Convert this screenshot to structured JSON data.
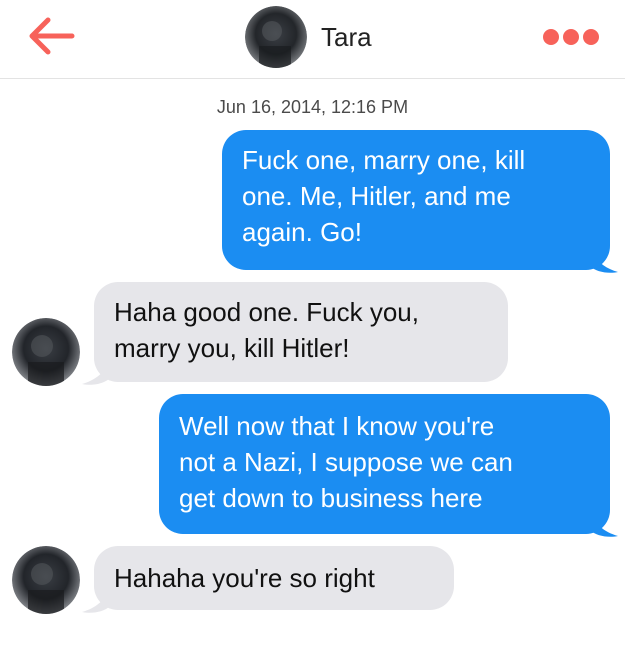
{
  "header": {
    "contact_name": "Tara",
    "back_icon": "back-arrow-icon",
    "more_icon": "more-dots-icon",
    "accent_color": "#f7625a"
  },
  "thread": {
    "timestamp": "Jun 16, 2014, 12:16 PM",
    "outgoing_color": "#1b8df2",
    "incoming_color": "#e6e6ea",
    "messages": [
      {
        "direction": "outgoing",
        "lines": [
          "Fuck one, marry one, kill",
          "one. Me, Hitler, and me",
          "again. Go!"
        ]
      },
      {
        "direction": "incoming",
        "lines": [
          "Haha good one. Fuck you,",
          "marry you, kill Hitler!"
        ]
      },
      {
        "direction": "outgoing",
        "lines": [
          "Well now that I know you're",
          "not a Nazi, I suppose we can",
          "get down to business here"
        ]
      },
      {
        "direction": "incoming",
        "lines": [
          "Hahaha you're so right"
        ]
      }
    ]
  }
}
